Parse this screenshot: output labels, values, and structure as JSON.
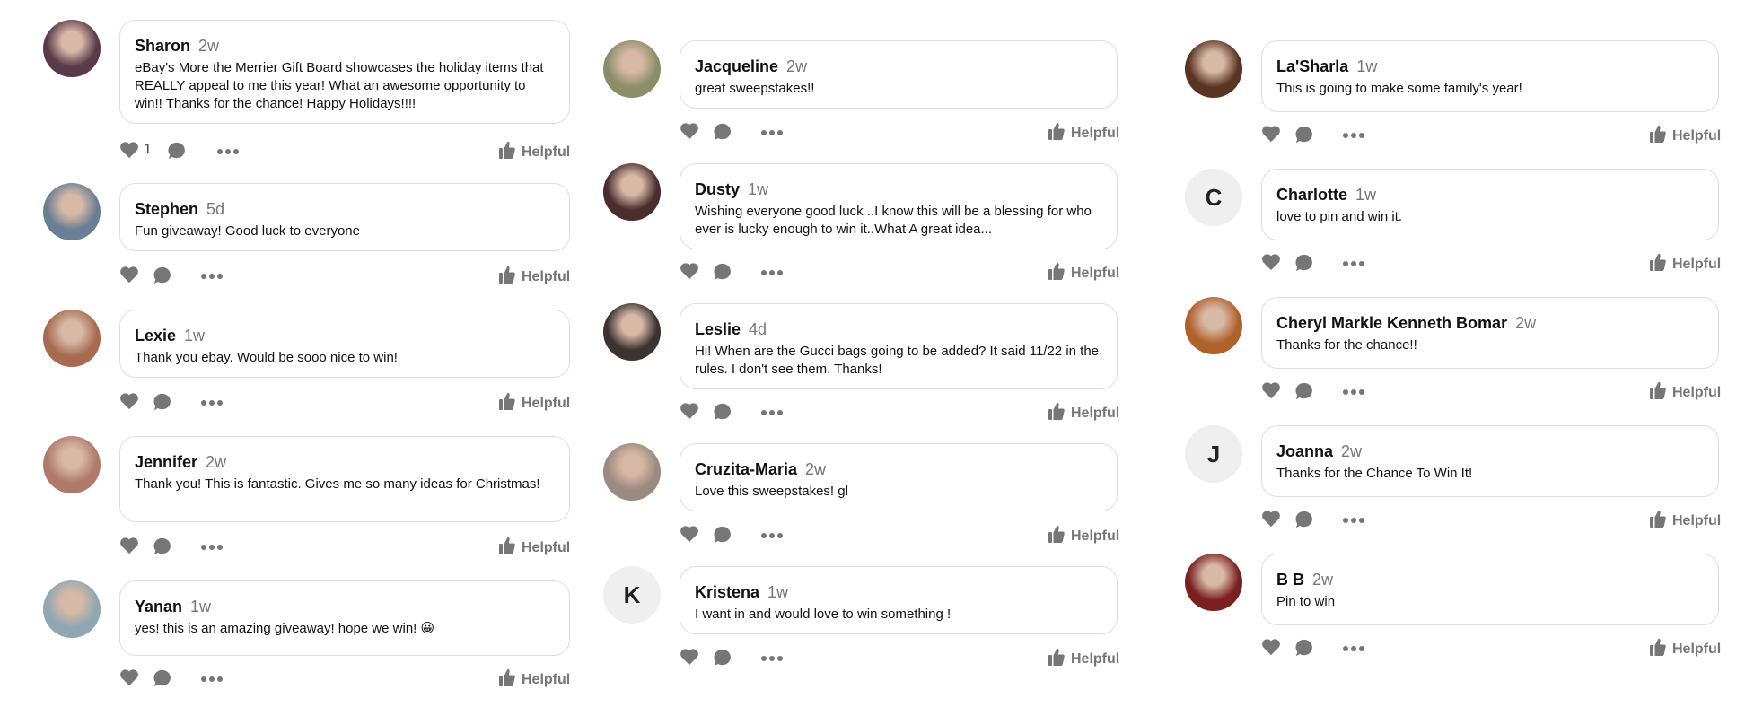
{
  "ui": {
    "helpful_label": "Helpful"
  },
  "columns": [
    {
      "comments": [
        {
          "name": "Sharon",
          "time": "2w",
          "text": "eBay's More the Merrier Gift Board showcases the holiday items that REALLY appeal to me this year! What an awesome opportunity to win!! Thanks for the chance! Happy Holidays!!!!",
          "likes": "1",
          "avatar_color": "#5a3a4a"
        },
        {
          "name": "Stephen",
          "time": "5d",
          "text": "Fun giveaway! Good luck to everyone",
          "likes": "",
          "avatar_color": "#6a7f94"
        },
        {
          "name": "Lexie",
          "time": "1w",
          "text": "Thank you ebay. Would be sooo nice to win!",
          "likes": "",
          "avatar_color": "#a86b52"
        },
        {
          "name": "Jennifer",
          "time": "2w",
          "text": "Thank you! This is fantastic. Gives me so many ideas for Christmas!",
          "likes": "",
          "avatar_color": "#b07a6a"
        },
        {
          "name": "Yanan",
          "time": "1w",
          "text": "yes! this is an amazing giveaway! hope we win! 😀",
          "likes": "",
          "avatar_color": "#8fa7b2"
        }
      ]
    },
    {
      "comments": [
        {
          "name": "Jacqueline",
          "time": "2w",
          "text": "great sweepstakes!!",
          "likes": "",
          "avatar_color": "#8a8f6a"
        },
        {
          "name": "Dusty",
          "time": "1w",
          "text": "Wishing everyone good luck ..I know this will be a blessing for who ever is lucky enough to win it..What A great idea...",
          "likes": "",
          "avatar_color": "#4a2e2e"
        },
        {
          "name": "Leslie",
          "time": "4d",
          "text": "Hi! When are the Gucci bags going to be added? It said 11/22 in the rules. I don't see them. Thanks!",
          "likes": "",
          "avatar_color": "#3a3330"
        },
        {
          "name": "Cruzita-Maria",
          "time": "2w",
          "text": "Love this sweepstakes! gl",
          "likes": "",
          "avatar_color": "#9a8a80"
        },
        {
          "name": "Kristena",
          "time": "1w",
          "text": "I want in and would love to win something !",
          "likes": "",
          "avatar_initial": "K"
        }
      ]
    },
    {
      "comments": [
        {
          "name": "La'Sharla",
          "time": "1w",
          "text": "This is going to make some family's year!",
          "likes": "",
          "avatar_color": "#5a3422"
        },
        {
          "name": "Charlotte",
          "time": "1w",
          "text": "love to pin and win it.",
          "likes": "",
          "avatar_initial": "C"
        },
        {
          "name": "Cheryl Markle Kenneth Bomar",
          "time": "2w",
          "text": "Thanks for the chance!!",
          "likes": "",
          "avatar_color": "#b0602a"
        },
        {
          "name": "Joanna",
          "time": "2w",
          "text": "Thanks for the Chance To Win It!",
          "likes": "",
          "avatar_initial": "J"
        },
        {
          "name": "B B",
          "time": "2w",
          "text": "Pin to win",
          "likes": "",
          "avatar_color": "#7a2020"
        }
      ]
    }
  ]
}
